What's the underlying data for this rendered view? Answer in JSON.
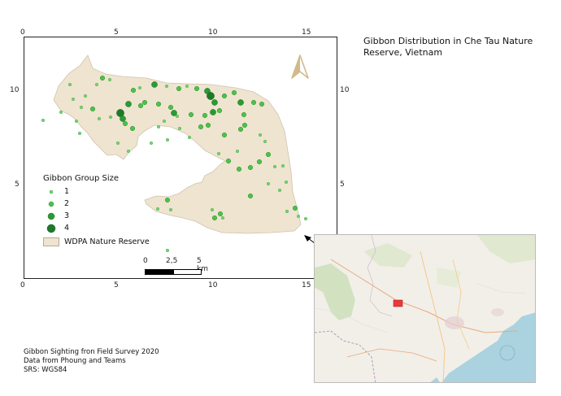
{
  "title": "Gibbon Distribution in Che Tau Nature Reserve, Vietnam",
  "axis_ticks": {
    "top": [
      "0",
      "5",
      "10",
      "15"
    ],
    "bottom": [
      "0",
      "5",
      "10",
      "15"
    ],
    "left": [
      "10",
      "5"
    ],
    "right": [
      "10",
      "5"
    ]
  },
  "legend": {
    "title": "Gibbon Group Size",
    "items": [
      {
        "label": "1",
        "size": 1
      },
      {
        "label": "2",
        "size": 2
      },
      {
        "label": "3",
        "size": 3
      },
      {
        "label": "4",
        "size": 4
      }
    ],
    "reserve_label": "WDPA Nature Reserve"
  },
  "scalebar": {
    "labels": [
      "0",
      "2,5",
      "5 km"
    ]
  },
  "footer": {
    "line1": "Gibbon Sighting fron Field Survey 2020",
    "line2": "Data from Phoung and Teams",
    "line3": "SRS: WGS84"
  },
  "colors": {
    "reserve_fill": "#efe4cf",
    "reserve_stroke": "#cfc3ad",
    "point_light": "#72d672",
    "point_mid": "#4cc24c",
    "point_dark": "#2a9a35",
    "point_darkest": "#1e7a2a",
    "north_arrow": "#d2b98c",
    "sea": "#aad3df",
    "land": "#f2efe9",
    "inset_marker": "#e83a3a"
  },
  "icons": {
    "north": "north-arrow-icon"
  }
}
